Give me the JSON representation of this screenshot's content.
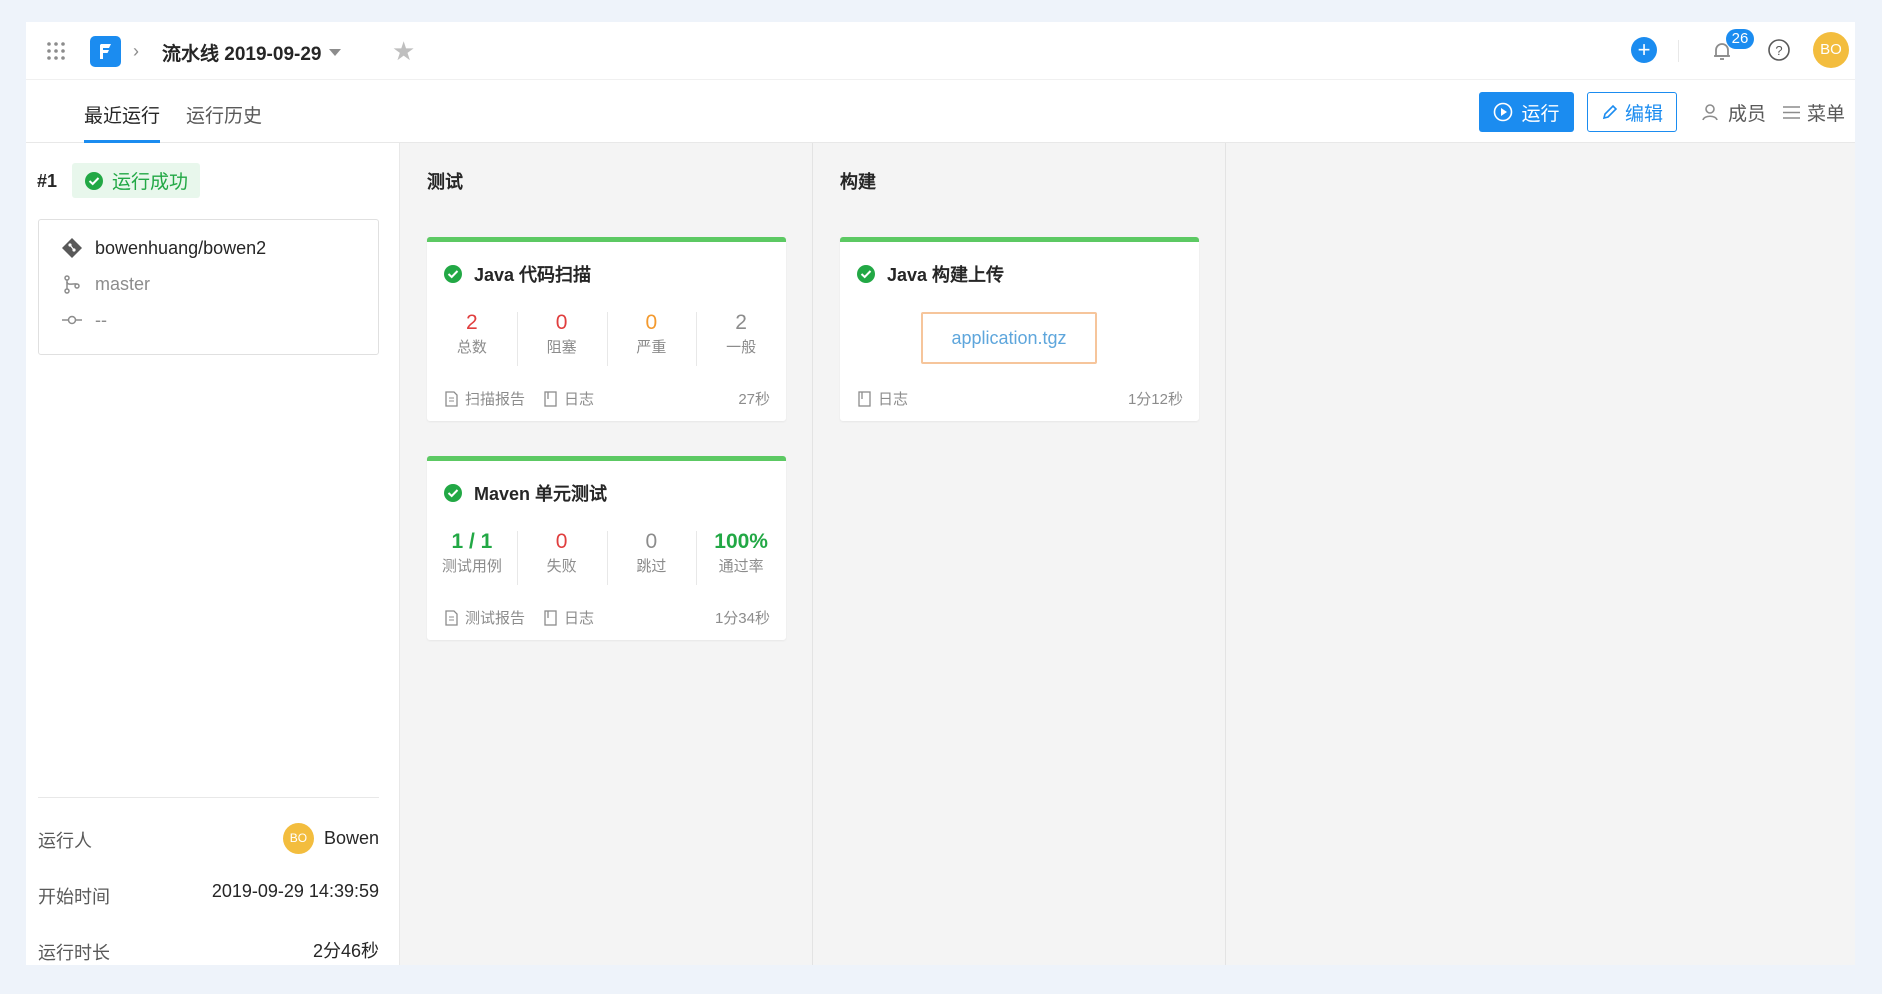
{
  "header": {
    "pipeline_name": "流水线 2019-09-29",
    "notification_count": "26",
    "user_initials": "BO"
  },
  "tabs": [
    {
      "label": "最近运行",
      "active": true
    },
    {
      "label": "运行历史",
      "active": false
    }
  ],
  "actions": {
    "run": "运行",
    "edit": "编辑",
    "members": "成员",
    "menu": "菜单"
  },
  "run": {
    "number": "#1",
    "status": "运行成功",
    "repo": "bowenhuang/bowen2",
    "branch": "master",
    "commit": "--",
    "runner_label": "运行人",
    "runner_initials": "BO",
    "runner_name": "Bowen",
    "start_label": "开始时间",
    "start_time": "2019-09-29 14:39:59",
    "duration_label": "运行时长",
    "duration": "2分46秒"
  },
  "stages": [
    {
      "title": "测试",
      "jobs": [
        {
          "name": "Java 代码扫描",
          "stats": [
            {
              "value": "2",
              "label": "总数",
              "color": "#e03e3e"
            },
            {
              "value": "0",
              "label": "阻塞",
              "color": "#e03e3e"
            },
            {
              "value": "0",
              "label": "严重",
              "color": "#f39a2f"
            },
            {
              "value": "2",
              "label": "一般",
              "color": "#8c8c8c"
            }
          ],
          "links": [
            "扫描报告",
            "日志"
          ],
          "duration": "27秒"
        },
        {
          "name": "Maven 单元测试",
          "stats": [
            {
              "value": "1 / 1",
              "label": "测试用例",
              "color": "#22a845"
            },
            {
              "value": "0",
              "label": "失败",
              "color": "#e03e3e"
            },
            {
              "value": "0",
              "label": "跳过",
              "color": "#8c8c8c"
            },
            {
              "value": "100%",
              "label": "通过率",
              "color": "#22a845"
            }
          ],
          "links": [
            "测试报告",
            "日志"
          ],
          "duration": "1分34秒"
        }
      ]
    },
    {
      "title": "构建",
      "jobs": [
        {
          "name": "Java 构建上传",
          "artifact": "application.tgz",
          "links": [
            "日志"
          ],
          "duration": "1分12秒"
        }
      ]
    }
  ],
  "colors": {
    "accent": "#1b8cf0",
    "success": "#22a845",
    "card_top_border": "#5cc963",
    "avatar": "#f3bd3e"
  }
}
